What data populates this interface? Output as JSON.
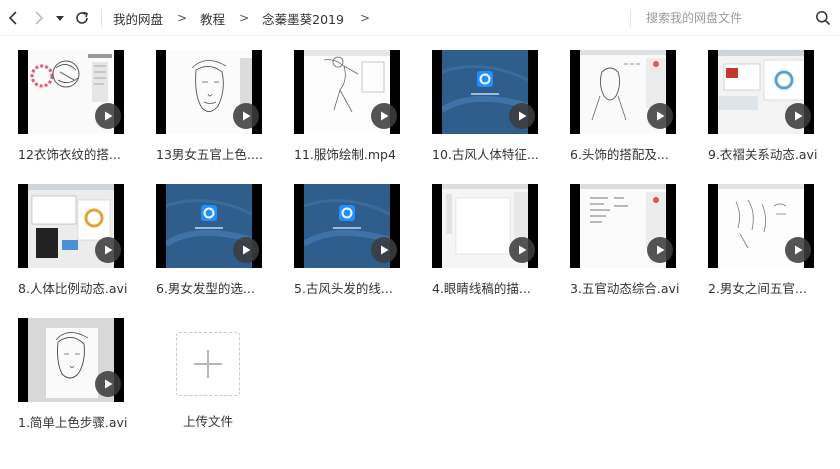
{
  "toolbar": {
    "back_icon": "chevron-left-icon",
    "forward_icon": "chevron-right-icon",
    "history_icon": "caret-down-icon",
    "refresh_icon": "refresh-icon"
  },
  "breadcrumb": {
    "items": [
      "我的网盘",
      "教程",
      "念蓁墨葵2019"
    ],
    "separator": ">"
  },
  "search": {
    "placeholder": "搜索我的网盘文件",
    "icon": "search-icon"
  },
  "files": [
    {
      "name": "12衣饰衣纹的搭...",
      "thumb": "sketch-round"
    },
    {
      "name": "13男女五官上色....",
      "thumb": "sketch-face"
    },
    {
      "name": "11.服饰绘制.mp4",
      "thumb": "sketch-figure"
    },
    {
      "name": "10.古风人体特征...",
      "thumb": "blue-logo"
    },
    {
      "name": "6.头饰的搭配及...",
      "thumb": "sketch-app"
    },
    {
      "name": "9.衣褶关系动态.avi",
      "thumb": "desktop-ui"
    },
    {
      "name": "8.人体比例动态.avi",
      "thumb": "desktop-dark"
    },
    {
      "name": "6.男女发型的选...",
      "thumb": "blue-logo"
    },
    {
      "name": "5.古风头发的线...",
      "thumb": "blue-logo"
    },
    {
      "name": "4.眼睛线稿的描...",
      "thumb": "blank-app"
    },
    {
      "name": "3.五官动态综合.avi",
      "thumb": "text-app"
    },
    {
      "name": "2.男女之间五官...",
      "thumb": "sketch-lines"
    },
    {
      "name": "1.简单上色步骤.avi",
      "thumb": "gray-sketch"
    }
  ],
  "upload": {
    "label": "上传文件",
    "icon": "plus-icon"
  },
  "colors": {
    "accent_blue": "#2f5d8c",
    "logo_blue": "#1e90ff",
    "play_button": "#3c3c3c"
  }
}
